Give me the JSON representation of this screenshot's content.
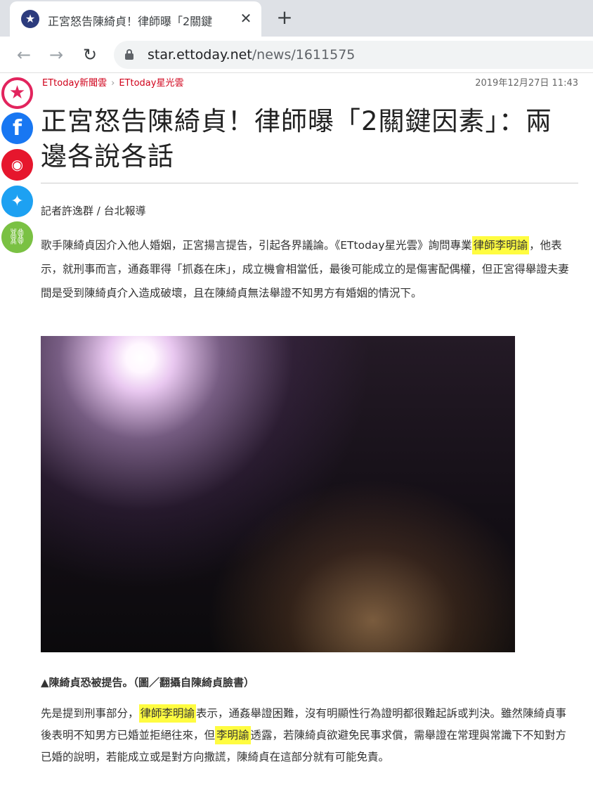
{
  "browser": {
    "tab_title": "正宮怒告陳綺貞！律師曝「2關鍵",
    "url_host": "star.ettoday.net",
    "url_path": "/news/1611575",
    "icons": {
      "favicon": "star-icon",
      "close": "close-icon",
      "new_tab": "plus-icon",
      "back": "arrow-left-icon",
      "forward": "arrow-right-icon",
      "reload": "reload-icon",
      "lock": "lock-icon"
    }
  },
  "share": {
    "items": [
      "favorite-star-icon",
      "facebook-icon",
      "weibo-icon",
      "twitter-icon",
      "link-icon"
    ]
  },
  "article": {
    "breadcrumb": [
      "ETtoday新聞雲",
      "ETtoday星光雲"
    ],
    "breadcrumb_sep": "›",
    "date": "2019年12月27日 11:43",
    "title": "正宮怒告陳綺貞！律師曝「2關鍵因素」：兩邊各說各話",
    "byline": "記者許逸群 / 台北報導",
    "p1": [
      {
        "t": "歌手陳綺貞因介入他人婚姻，正宮揚言提告，引起各界議論。《ETtoday星光雲》詢問專業"
      },
      {
        "t": "律師李明諭",
        "hl": true
      },
      {
        "t": "，他表示，就刑事而言，通姦罪得「抓姦在床」，成立機會相當低，最後可能成立的是傷害配偶權，但正宮得舉證夫妻間是受到陳綺貞介入造成破壞，且在陳綺貞無法舉證不知男方有婚姻的情況下。"
      }
    ],
    "caption": "▲陳綺貞恐被提告。（圖／翻攝自陳綺貞臉書）",
    "p2": [
      {
        "t": "先是提到刑事部分，"
      },
      {
        "t": "律師李明諭",
        "hl": true
      },
      {
        "t": "表示，通姦舉證困難，沒有明顯性行為證明都很難起訴或判決。雖然陳綺貞事後表明不知男方已婚並拒絕往來，但"
      },
      {
        "t": "李明諭",
        "hl": true
      },
      {
        "t": "透露，若陳綺貞欲避免民事求償，需舉證在常理與常識下不知對方已婚的說明，若能成立或是對方向撒謊，陳綺貞在這部分就有可能免責。"
      }
    ]
  },
  "colors": {
    "accent": "#d0021b",
    "highlight": "#fffc40",
    "facebook": "#1877f2",
    "weibo": "#e6162d",
    "twitter": "#1da1f2",
    "link": "#7ac143",
    "favorite": "#e2245d"
  }
}
